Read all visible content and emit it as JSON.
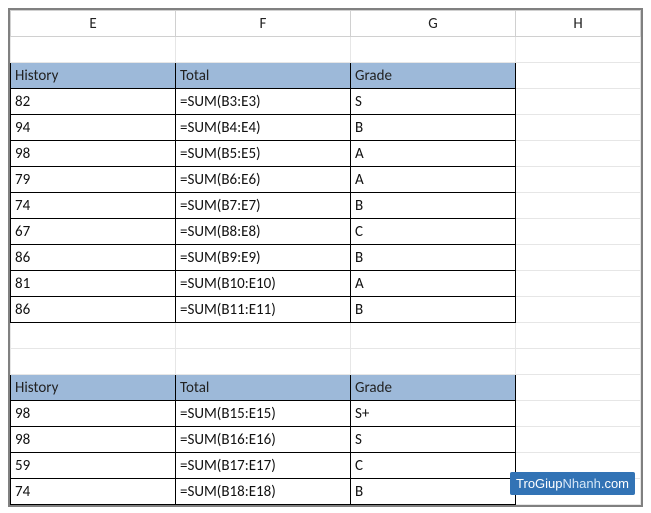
{
  "columns": {
    "E": "E",
    "F": "F",
    "G": "G",
    "H": "H"
  },
  "table1": {
    "headers": {
      "c1": "History",
      "c2": "Total",
      "c3": "Grade"
    },
    "rows": [
      {
        "c1": "82",
        "c2": "=SUM(B3:E3)",
        "c3": "S"
      },
      {
        "c1": "94",
        "c2": "=SUM(B4:E4)",
        "c3": "B"
      },
      {
        "c1": "98",
        "c2": "=SUM(B5:E5)",
        "c3": "A"
      },
      {
        "c1": "79",
        "c2": "=SUM(B6:E6)",
        "c3": "A"
      },
      {
        "c1": "74",
        "c2": "=SUM(B7:E7)",
        "c3": "B"
      },
      {
        "c1": "67",
        "c2": "=SUM(B8:E8)",
        "c3": "C"
      },
      {
        "c1": "86",
        "c2": "=SUM(B9:E9)",
        "c3": "B"
      },
      {
        "c1": "81",
        "c2": "=SUM(B10:E10)",
        "c3": "A"
      },
      {
        "c1": "86",
        "c2": "=SUM(B11:E11)",
        "c3": "B"
      }
    ]
  },
  "table2": {
    "headers": {
      "c1": "History",
      "c2": "Total",
      "c3": "Grade"
    },
    "rows": [
      {
        "c1": "98",
        "c2": "=SUM(B15:E15)",
        "c3": "S+"
      },
      {
        "c1": "98",
        "c2": "=SUM(B16:E16)",
        "c3": "S"
      },
      {
        "c1": "59",
        "c2": "=SUM(B17:E17)",
        "c3": "C"
      },
      {
        "c1": "74",
        "c2": "=SUM(B18:E18)",
        "c3": "B"
      }
    ]
  },
  "watermark": {
    "a": "TroGiup",
    "b": "Nhanh",
    "c": ".com"
  }
}
